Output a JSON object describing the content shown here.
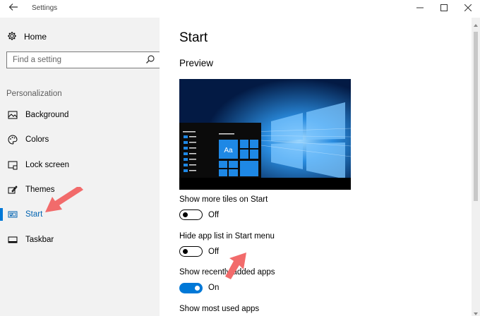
{
  "window": {
    "title": "Settings",
    "back_icon": "back-arrow-icon",
    "controls": [
      "minimize-icon",
      "maximize-icon",
      "close-icon"
    ]
  },
  "sidebar": {
    "home_label": "Home",
    "search_placeholder": "Find a setting",
    "section": "Personalization",
    "items": [
      {
        "label": "Background",
        "icon": "background-icon"
      },
      {
        "label": "Colors",
        "icon": "colors-icon"
      },
      {
        "label": "Lock screen",
        "icon": "lock-screen-icon"
      },
      {
        "label": "Themes",
        "icon": "themes-icon"
      },
      {
        "label": "Start",
        "icon": "start-icon",
        "active": true
      },
      {
        "label": "Taskbar",
        "icon": "taskbar-icon"
      }
    ]
  },
  "main": {
    "title": "Start",
    "preview_heading": "Preview",
    "preview_tile_label": "Aa",
    "settings": [
      {
        "label": "Show more tiles on Start",
        "state": "Off",
        "on": false
      },
      {
        "label": "Hide app list in Start menu",
        "state": "Off",
        "on": false
      },
      {
        "label": "Show recently added apps",
        "state": "On",
        "on": true
      },
      {
        "label": "Show most used apps"
      }
    ]
  },
  "colors": {
    "accent": "#0078d7",
    "annotation_arrow": "#f26b6b"
  }
}
